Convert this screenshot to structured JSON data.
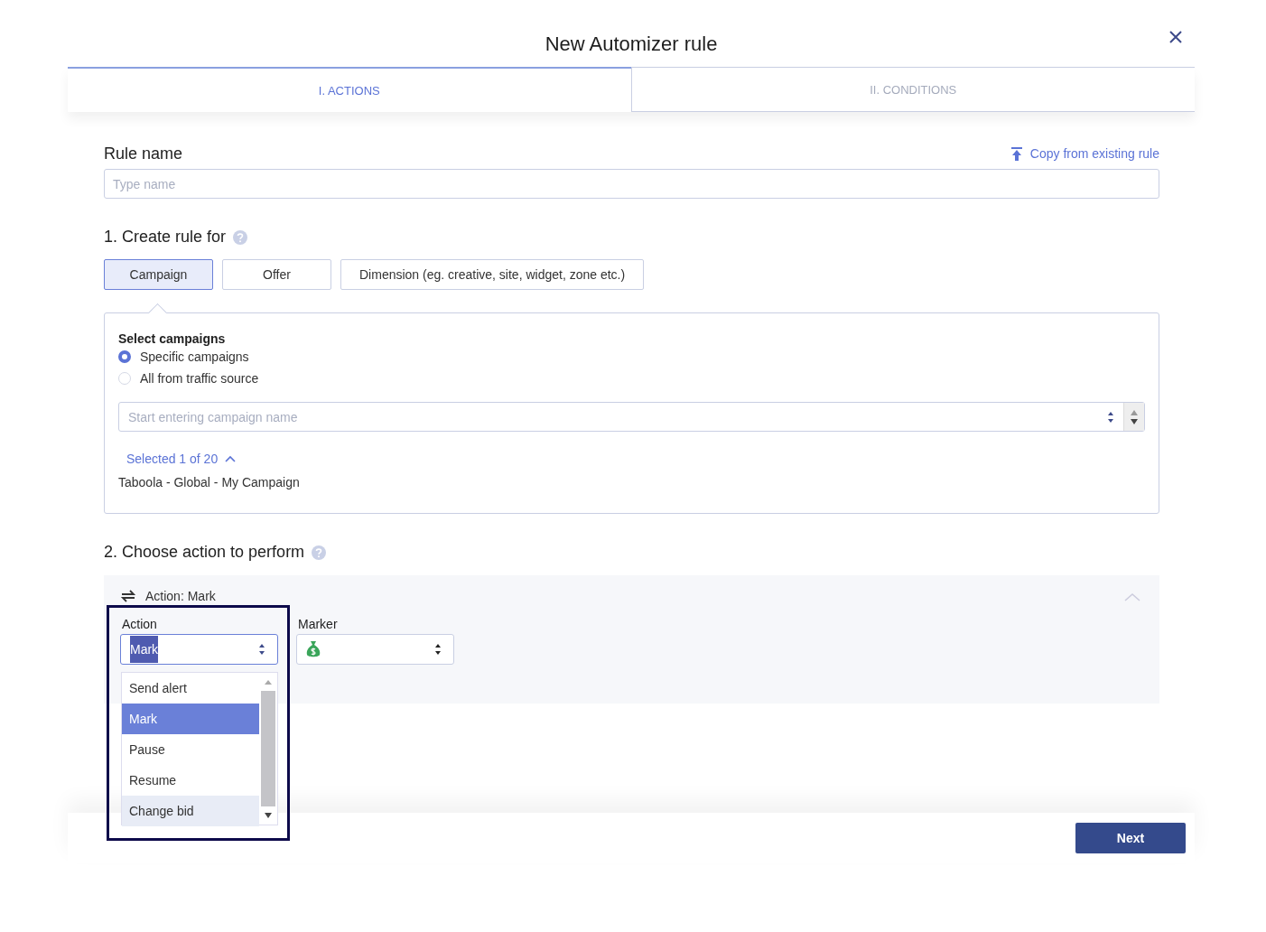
{
  "dialog": {
    "title": "New Automizer rule"
  },
  "tabs": [
    {
      "label": "I. ACTIONS",
      "selected": true
    },
    {
      "label": "II. CONDITIONS",
      "selected": false
    }
  ],
  "rule_name": {
    "label": "Rule name",
    "placeholder": "Type name",
    "copy_link": "Copy from existing rule"
  },
  "create_for": {
    "title": "1. Create rule for",
    "options": [
      {
        "label": "Campaign",
        "selected": true
      },
      {
        "label": "Offer",
        "selected": false
      },
      {
        "label": "Dimension (eg. creative, site, widget, zone etc.)",
        "selected": false
      }
    ]
  },
  "campaigns": {
    "label": "Select campaigns",
    "radios": [
      {
        "label": "Specific campaigns",
        "selected": true
      },
      {
        "label": "All from traffic source",
        "selected": false
      }
    ],
    "search_placeholder": "Start entering campaign name",
    "selected_toggle": {
      "label": "Selected 1 of 20",
      "expanded": true
    },
    "items": [
      "Taboola - Global - My Campaign"
    ]
  },
  "choose_action": {
    "title": "2. Choose action to perform",
    "panel": {
      "header": "Action: Mark",
      "expanded": true,
      "action_field": {
        "label": "Action",
        "value": "Mark",
        "options": [
          {
            "label": "Send alert",
            "selected": false,
            "hovered": false
          },
          {
            "label": "Mark",
            "selected": true,
            "hovered": false
          },
          {
            "label": "Pause",
            "selected": false,
            "hovered": false
          },
          {
            "label": "Resume",
            "selected": false,
            "hovered": false
          },
          {
            "label": "Change bid",
            "selected": false,
            "hovered": true
          }
        ]
      },
      "marker_field": {
        "label": "Marker"
      }
    }
  },
  "footer": {
    "next": "Next"
  }
}
